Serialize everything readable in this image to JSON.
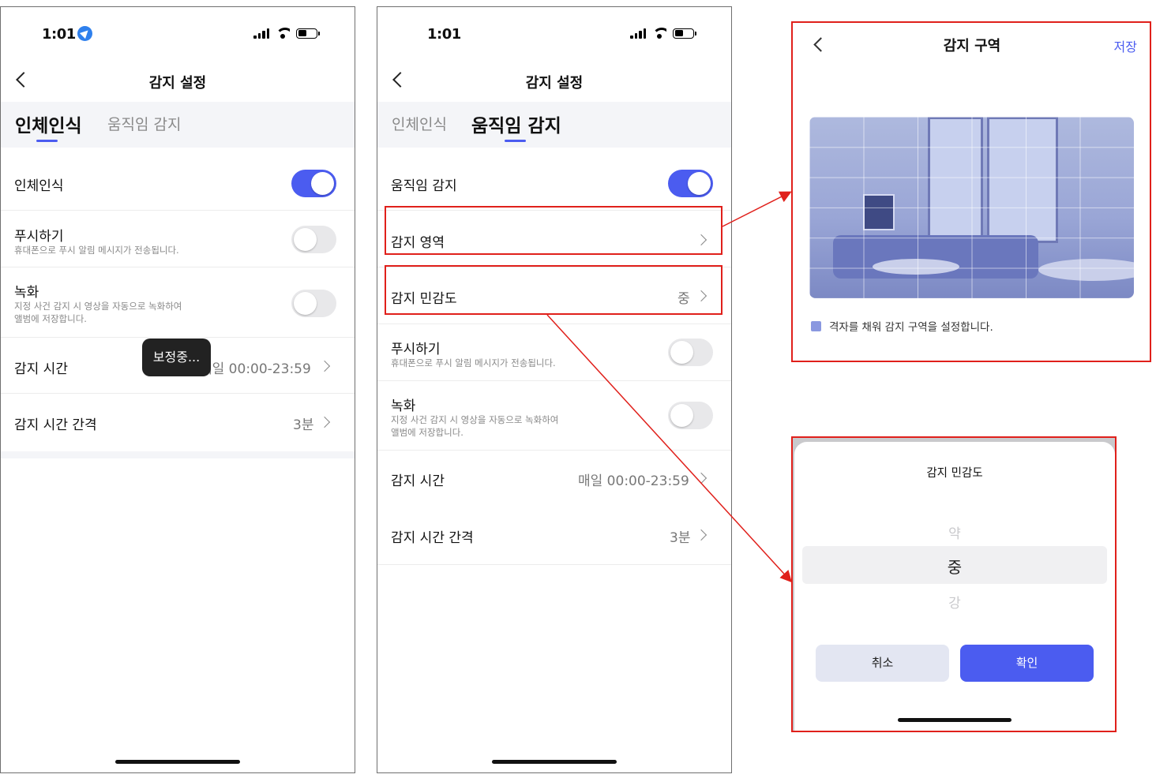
{
  "colors": {
    "accent": "#4b5cf0",
    "highlight_red": "#e0201b",
    "toggle_off": "#e8e8ea"
  },
  "phone1": {
    "status_time": "1:01",
    "nav_title": "감지 설정",
    "tabs": [
      {
        "label": "인체인식",
        "active": true
      },
      {
        "label": "움직임 감지",
        "active": false
      }
    ],
    "rows": {
      "human": {
        "title": "인체인식",
        "toggle": "on"
      },
      "push": {
        "title": "푸시하기",
        "subtitle": "휴대폰으로 푸시 알림 메시지가 전송됩니다.",
        "toggle": "off"
      },
      "record": {
        "title": "녹화",
        "subtitle_line1": "지정 사건  감지 시 영상을 자동으로 녹화하여",
        "subtitle_line2": "앨범에 저장합니다.",
        "toggle": "off"
      },
      "time": {
        "title": "감지 시간",
        "value": "매일 00:00-23:59"
      },
      "interval": {
        "title": "감지 시간 간격",
        "value": "3분"
      }
    },
    "toast": "보정중..."
  },
  "phone2": {
    "status_time": "1:01",
    "nav_title": "감지 설정",
    "tabs": [
      {
        "label": "인체인식",
        "active": false
      },
      {
        "label": "움직임 감지",
        "active": true
      }
    ],
    "rows": {
      "motion": {
        "title": "움직임 감지",
        "toggle": "on"
      },
      "area": {
        "title": "감지 영역"
      },
      "sensitivity": {
        "title": "감지 민감도",
        "value": "중"
      },
      "push": {
        "title": "푸시하기",
        "subtitle": "휴대폰으로 푸시 알림 메시지가 전송됩니다.",
        "toggle": "off"
      },
      "record": {
        "title": "녹화",
        "subtitle_line1": "지정 사건  감지 시 영상을 자동으로 녹화하여",
        "subtitle_line2": "앨범에 저장합니다.",
        "toggle": "off"
      },
      "time": {
        "title": "감지 시간",
        "value": "매일 00:00-23:59"
      },
      "interval": {
        "title": "감지 시간 간격",
        "value": "3분"
      }
    }
  },
  "zone_panel": {
    "title": "감지 구역",
    "save": "저장",
    "legend": "격자를 채워 감지 구역을 설정합니다.",
    "image": "camera-room-preview"
  },
  "sensitivity_panel": {
    "title": "감지 민감도",
    "options": [
      "약",
      "중",
      "강"
    ],
    "selected": "중",
    "cancel": "취소",
    "confirm": "확인"
  }
}
